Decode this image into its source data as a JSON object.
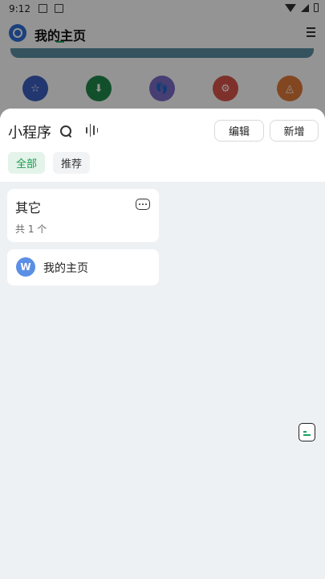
{
  "statusbar": {
    "time": "9:12"
  },
  "background": {
    "app_title": "我的主页",
    "icons": [
      {
        "name": "star-icon",
        "glyph": "☆",
        "color": "#3b5fbf"
      },
      {
        "name": "download-icon",
        "glyph": "⬇",
        "color": "#1f8a4a"
      },
      {
        "name": "footprint-icon",
        "glyph": "👣",
        "color": "#7a6cc9"
      },
      {
        "name": "settings-icon",
        "glyph": "⚙",
        "color": "#d9554a"
      },
      {
        "name": "share-icon",
        "glyph": "◬",
        "color": "#e07a3a"
      }
    ]
  },
  "sheet": {
    "title": "小程序",
    "edit_label": "编辑",
    "add_label": "新增",
    "tabs": [
      {
        "label": "全部",
        "active": true
      },
      {
        "label": "推荐",
        "active": false
      }
    ],
    "group": {
      "title": "其它",
      "count": "共 1 个"
    },
    "apps": [
      {
        "icon_letter": "W",
        "name": "我的主页"
      }
    ]
  }
}
